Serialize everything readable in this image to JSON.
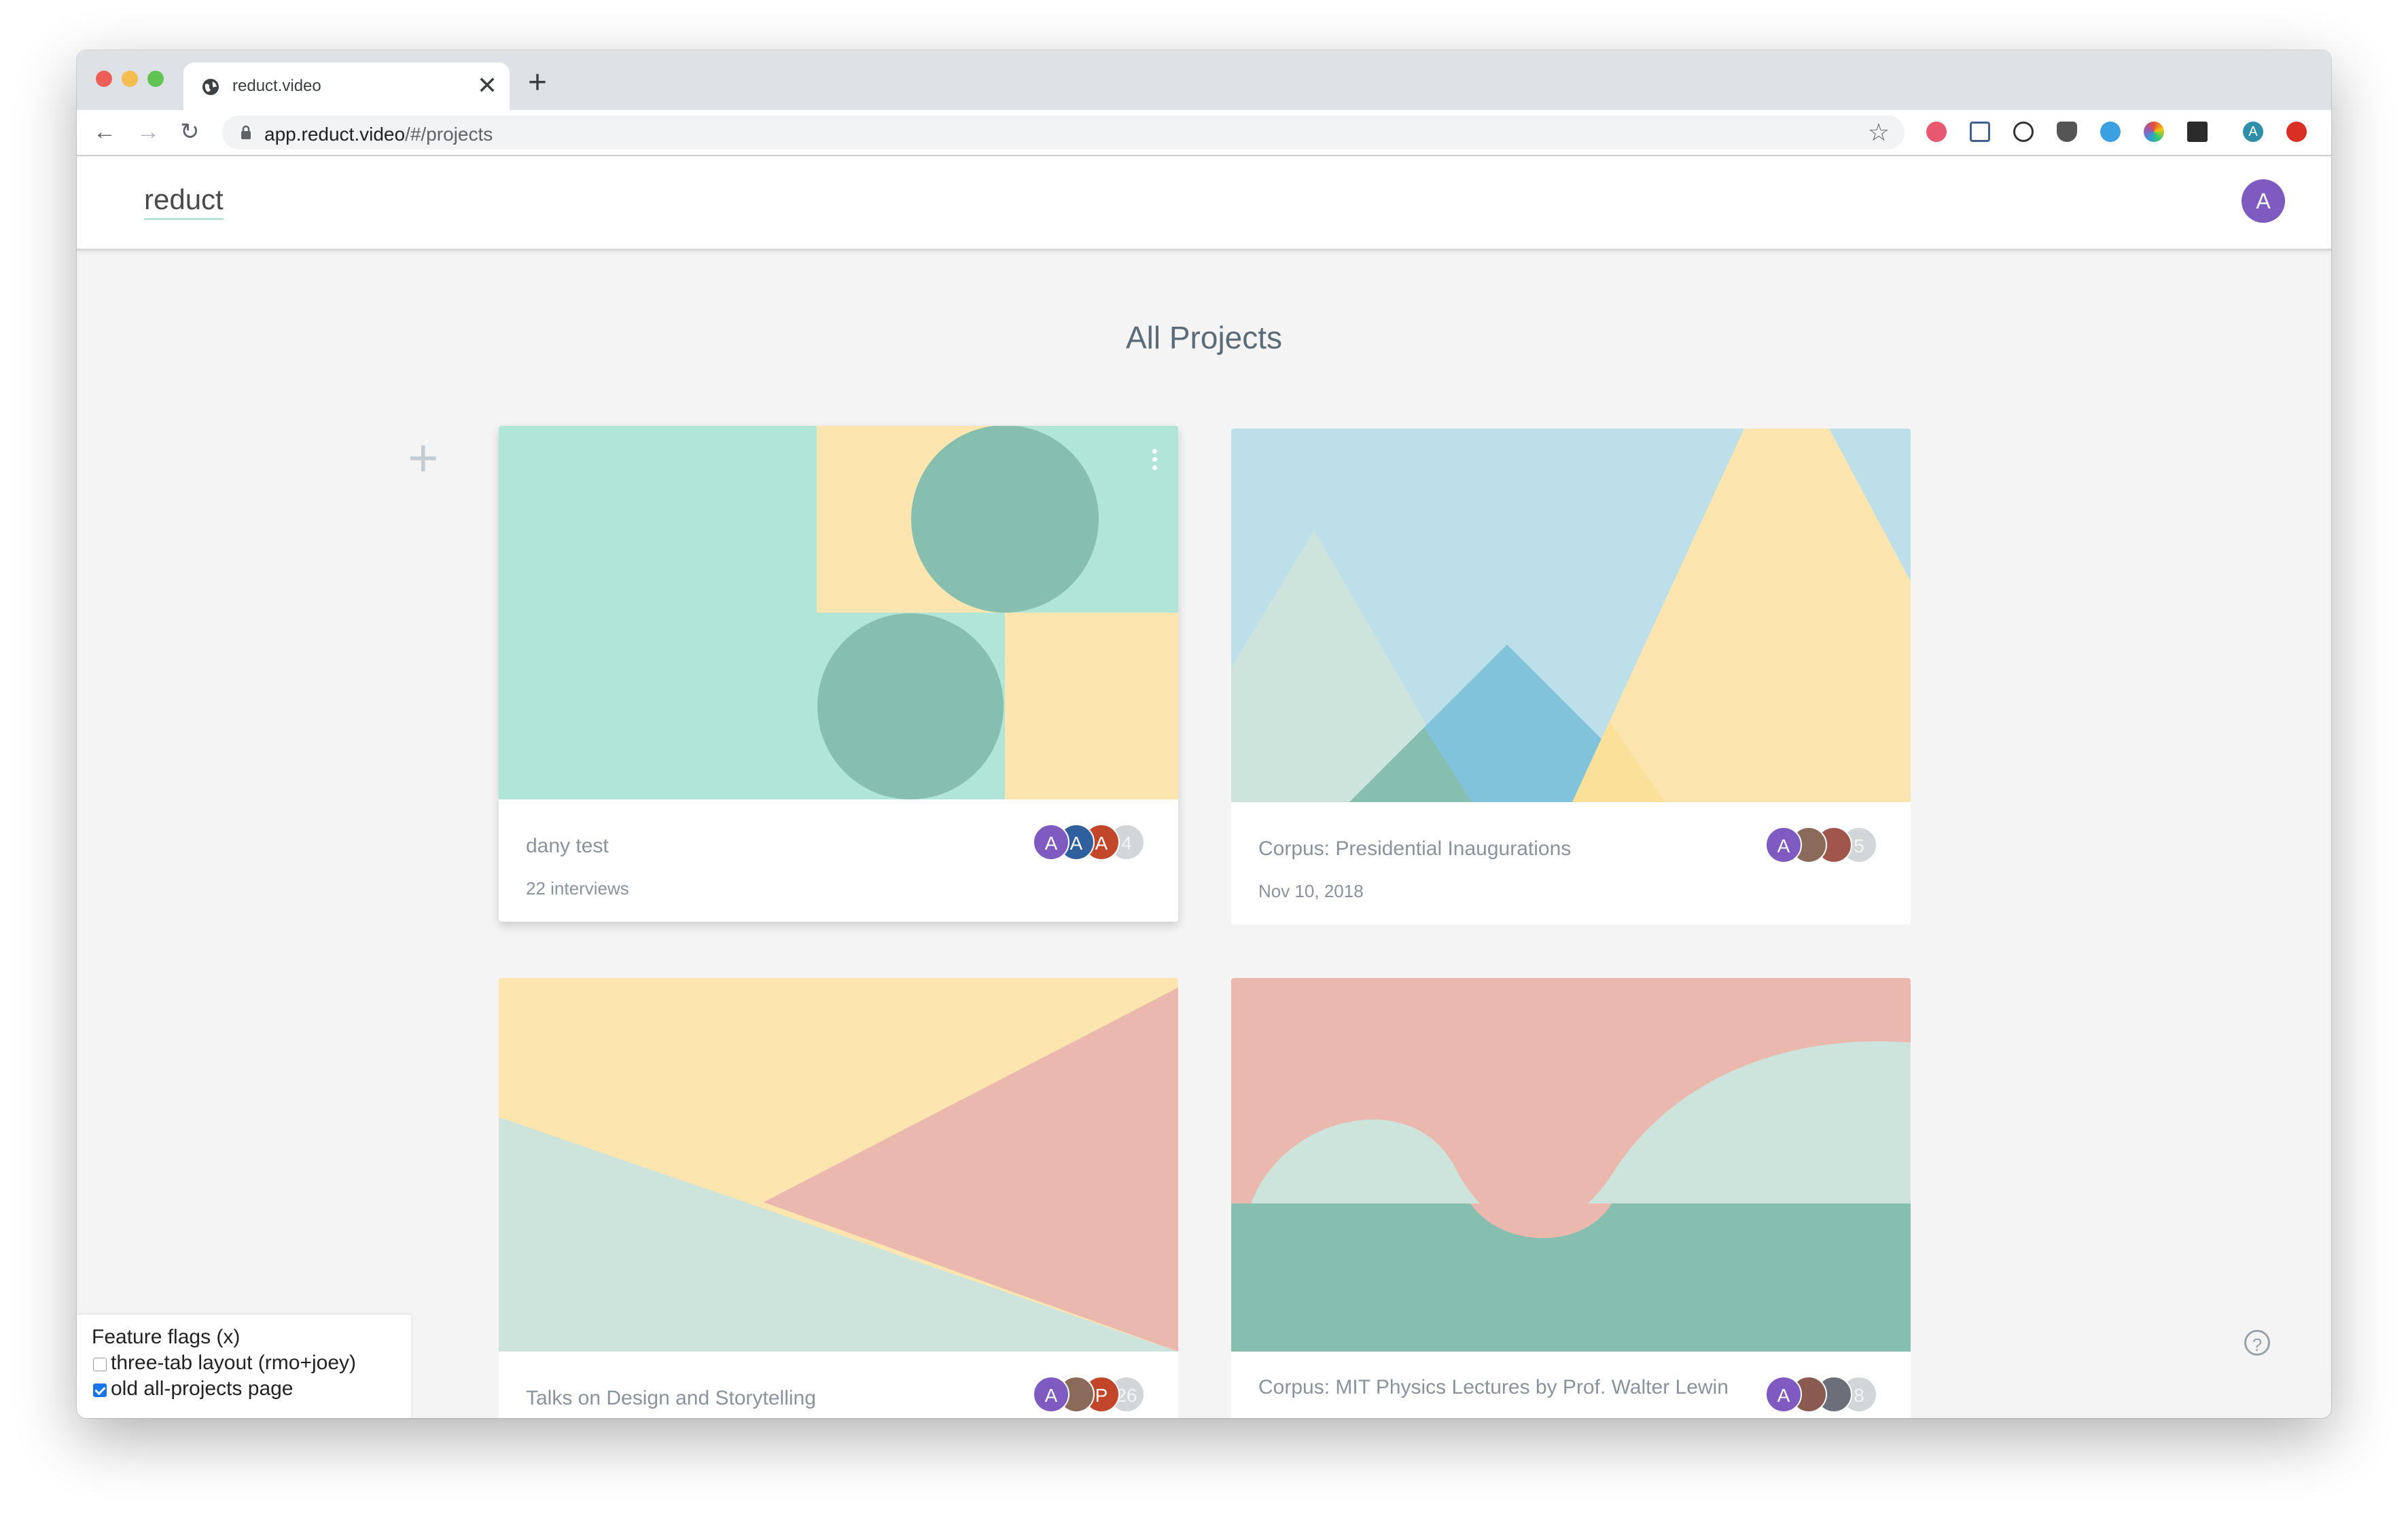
{
  "browser": {
    "tab_title": "reduct.video",
    "tab_close": "✕",
    "new_tab": "+",
    "url_host": "app.reduct.video",
    "url_path": "/#/projects",
    "back": "←",
    "forward": "→",
    "reload": "↻",
    "star": "☆",
    "traffic_lights": [
      "#ee5e58",
      "#f5bd4f",
      "#5fc454"
    ],
    "profile_initial": "A"
  },
  "app": {
    "logo": "reduct",
    "user_initial": "A",
    "user_color": "#7f5ac0"
  },
  "page": {
    "title": "All Projects",
    "add_label": "+"
  },
  "projects": [
    {
      "name": "dany test",
      "meta": "22 interviews",
      "avatars": [
        {
          "label": "A",
          "color": "#7f5ac0"
        },
        {
          "label": "A",
          "color": "#2f5f9c"
        },
        {
          "label": "A",
          "color": "#c2472a"
        }
      ],
      "more": "4",
      "art": "squares"
    },
    {
      "name": "Corpus: Presidential Inaugurations",
      "meta": "Nov 10, 2018",
      "avatars": [
        {
          "label": "A",
          "color": "#7f5ac0"
        },
        {
          "label": "",
          "color": "#8a6a58"
        },
        {
          "label": "",
          "color": "#a0564c"
        }
      ],
      "more": "5",
      "art": "mountains"
    },
    {
      "name": "Talks on Design and Storytelling",
      "meta": "",
      "avatars": [
        {
          "label": "A",
          "color": "#7f5ac0"
        },
        {
          "label": "",
          "color": "#8a6a58"
        },
        {
          "label": "P",
          "color": "#c2472a"
        }
      ],
      "more": "26",
      "art": "triangles"
    },
    {
      "name": "Corpus: MIT Physics Lectures by Prof. Walter Lewin",
      "meta": "",
      "avatars": [
        {
          "label": "A",
          "color": "#7f5ac0"
        },
        {
          "label": "",
          "color": "#8a5a50"
        },
        {
          "label": "",
          "color": "#6a6f7a"
        }
      ],
      "more": "8",
      "art": "waves"
    }
  ],
  "feature_flags": {
    "title": "Feature flags (x)",
    "items": [
      {
        "label": "three-tab layout (rmo+joey)",
        "checked": false
      },
      {
        "label": "old all-projects page",
        "checked": true
      }
    ]
  },
  "help": "?",
  "palette": {
    "mint": "#b1e5d7",
    "teal": "#86beb0",
    "sand": "#fde5b0",
    "sky": "#bcdfea",
    "blue": "#81c3da",
    "sage": "#cde4dd",
    "salmon": "#eab8ad",
    "yellow": "#fbe09a"
  }
}
